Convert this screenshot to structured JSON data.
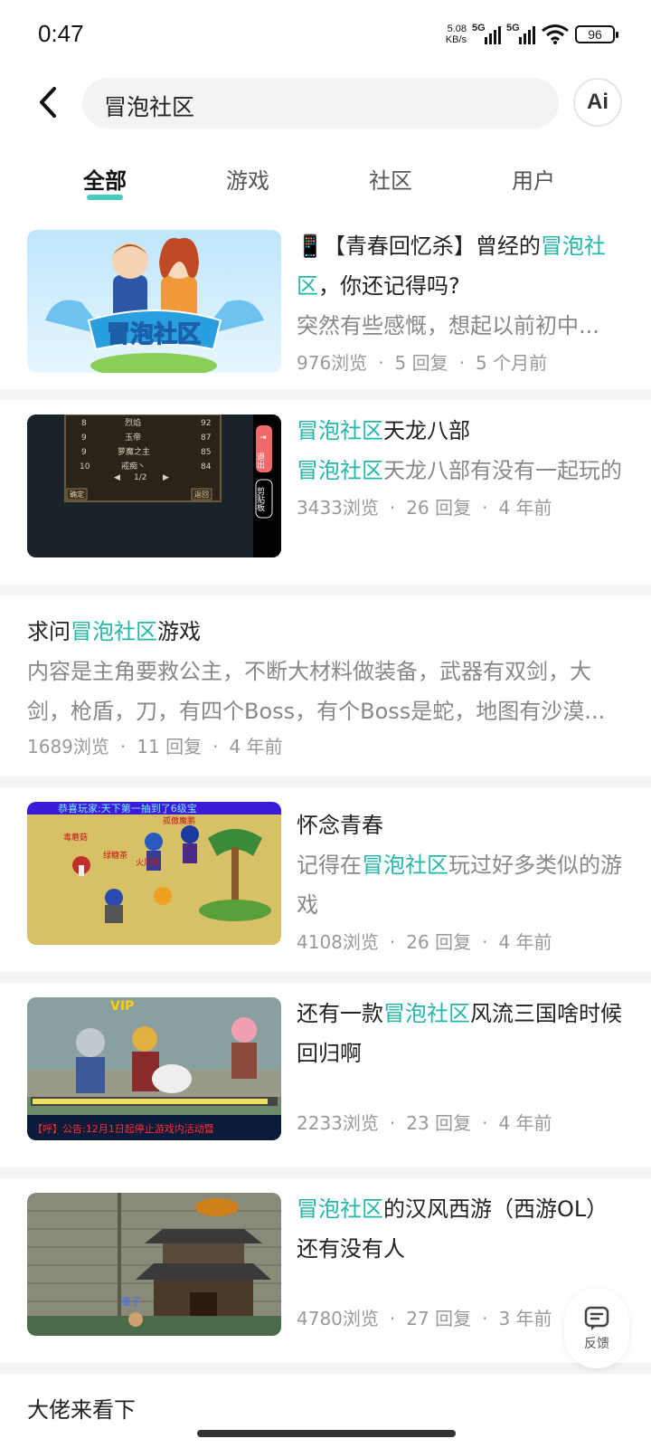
{
  "status": {
    "time": "0:47",
    "net_speed": "5.08",
    "net_unit": "KB/s",
    "sim1": "5G",
    "sim2": "5G",
    "wifi_sub": "6",
    "battery": "96"
  },
  "search": {
    "query": "冒泡社区",
    "ai_label": "Ai"
  },
  "tabs": [
    "全部",
    "游戏",
    "社区",
    "用户"
  ],
  "highlight_color": "#23b6a9",
  "posts": [
    {
      "title_pre": "📱【青春回忆杀】曾经的",
      "title_hl": "冒泡社区",
      "title_post": "，你还记得吗?",
      "desc": "突然有些感慨，想起以前初中...",
      "views": "976浏览",
      "replies": "5 回复",
      "time": "5 个月前"
    },
    {
      "title_hl": "冒泡社区",
      "title_post": "天龙八部",
      "desc_hl": "冒泡社区",
      "desc_post": "天龙八部有没有一起玩的",
      "views": "3433浏览",
      "replies": "26 回复",
      "time": "4 年前",
      "thumb_rows": [
        [
          "8",
          "烈焰",
          "92"
        ],
        [
          "9",
          "玉帝",
          "87"
        ],
        [
          "9",
          "萝魔之主",
          "85"
        ],
        [
          "10",
          "戒痴丶",
          "84"
        ]
      ],
      "thumb_page": "1/2",
      "thumb_ok": "确定",
      "thumb_back": "返回",
      "thumb_exit": "退出",
      "thumb_clip": "剪贴板"
    },
    {
      "title_pre": "求问",
      "title_hl": "冒泡社区",
      "title_post": "游戏",
      "desc": "内容是主角要救公主，不断大材料做装备，武器有双剑，大剑，枪盾，刀，有四个Boss，有个Boss是蛇，地图有沙漠...",
      "views": "1689浏览",
      "replies": "11 回复",
      "time": "4 年前"
    },
    {
      "title": "怀念青春",
      "desc_pre": "记得在",
      "desc_hl": "冒泡社区",
      "desc_post": "玩过好多类似的游戏",
      "views": "4108浏览",
      "replies": "26 回复",
      "time": "4 年前",
      "thumb_banner": "恭喜玩家:天下第一抽到了6级宝",
      "thumb_names": [
        "毒蘑菇",
        "绿糖茶",
        "火凤凰",
        "孤傲魔鹏"
      ]
    },
    {
      "title_pre": "还有一款",
      "title_hl": "冒泡社区",
      "title_post": "风流三国啥时候回归啊",
      "views": "2233浏览",
      "replies": "23 回复",
      "time": "4 年前",
      "thumb_vip": "VIP",
      "thumb_notice": "【呼】公告:12月1日起停止游戏内活动暨"
    },
    {
      "title_hl": "冒泡社区",
      "title_post": "的汉风西游（西游OL）还有没有人",
      "views": "4780浏览",
      "replies": "27 回复",
      "time": "3 年前",
      "thumb_name": "童子"
    },
    {
      "title": "大佬来看下"
    }
  ],
  "feedback_label": "反馈"
}
